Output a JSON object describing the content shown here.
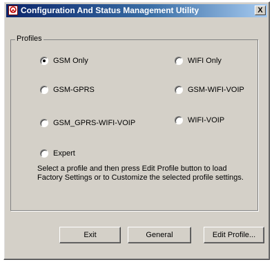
{
  "window": {
    "title": "Configuration And Status Management Utility",
    "close_label": "X",
    "app_icon": "app-logo-icon"
  },
  "profiles": {
    "group_label": "Profiles",
    "selected": "GSM Only",
    "options": [
      {
        "label": "GSM Only",
        "checked": true
      },
      {
        "label": "WIFI Only",
        "checked": false
      },
      {
        "label": "GSM-GPRS",
        "checked": false
      },
      {
        "label": "GSM-WIFI-VOIP",
        "checked": false
      },
      {
        "label": "GSM_GPRS-WIFI-VOIP",
        "checked": false
      },
      {
        "label": "WIFI-VOIP",
        "checked": false
      },
      {
        "label": "Expert",
        "checked": false
      }
    ],
    "instructions": "Select a profile and then press Edit Profile button to load Factory Settings or to Customize the selected profile settings."
  },
  "buttons": {
    "exit": "Exit",
    "general": "General",
    "edit_profile": "Edit Profile..."
  },
  "colors": {
    "titlebar_start": "#0a246a",
    "titlebar_end": "#a6caf0",
    "face": "#d4d0c8"
  }
}
